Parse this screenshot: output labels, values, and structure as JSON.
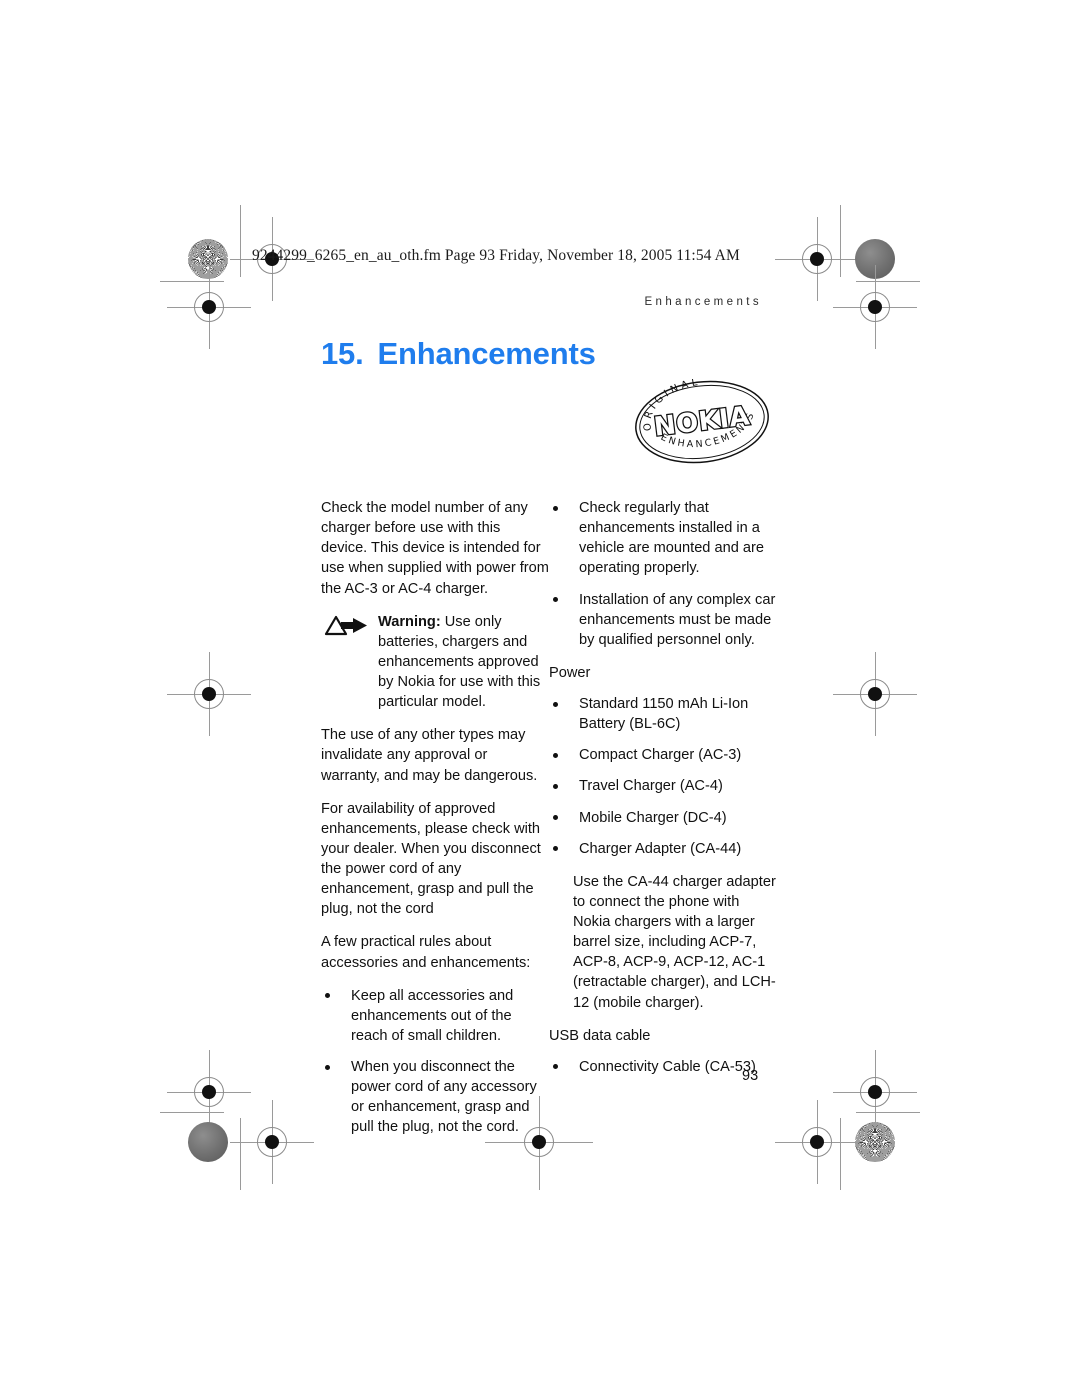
{
  "page": {
    "filename_line": "9244299_6265_en_au_oth.fm  Page 93  Friday, November 18, 2005  11:54 AM",
    "running_head": "Enhancements",
    "page_number": "93"
  },
  "title": {
    "number": "15.",
    "text": "Enhancements"
  },
  "badge": {
    "top_arc": "ORIGINAL",
    "center": "NOKIA",
    "bottom_arc": "ENHANCEMENTS"
  },
  "left_column": {
    "intro_paragraph": "Check the model number of any charger before use with this device. This device is intended for use when supplied with power from the AC-3 or AC-4 charger.",
    "warning": {
      "label": "Warning:",
      "text": " Use only batteries, chargers and enhancements approved by Nokia for use with this particular model."
    },
    "paragraph_2": "The use of any other types may invalidate any approval or warranty, and may be dangerous.",
    "paragraph_3": "For availability of approved enhancements, please check with your dealer. When you disconnect the power cord of any enhancement, grasp and pull the plug, not the cord",
    "rules_intro": "A few practical rules about accessories and enhancements:",
    "rules": [
      "Keep all accessories and enhancements out of the reach of small children.",
      "When you disconnect the power cord of any accessory or enhancement, grasp and pull the plug, not the cord."
    ]
  },
  "right_column": {
    "vehicle_bullets": [
      "Check regularly that enhancements installed in a vehicle are mounted and are operating properly.",
      "Installation of any complex car enhancements must be made by qualified personnel only."
    ],
    "power_label": "Power",
    "power_items": [
      "Standard 1150 mAh Li-Ion Battery (BL-6C)",
      "Compact Charger (AC-3)",
      "Travel Charger (AC-4)",
      "Mobile Charger (DC-4)",
      "Charger Adapter (CA-44)"
    ],
    "adapter_note": "Use the CA-44 charger adapter to connect the phone with Nokia chargers with a larger barrel size, including ACP-7, ACP-8, ACP-9, ACP-12, AC-1 (retractable charger), and LCH-12 (mobile charger).",
    "usb_label": "USB data cable",
    "usb_items": [
      "Connectivity Cable (CA-53)"
    ]
  },
  "colors": {
    "title_blue": "#1f7ded",
    "text": "#111111",
    "mark_gray": "#9a9a9a"
  }
}
